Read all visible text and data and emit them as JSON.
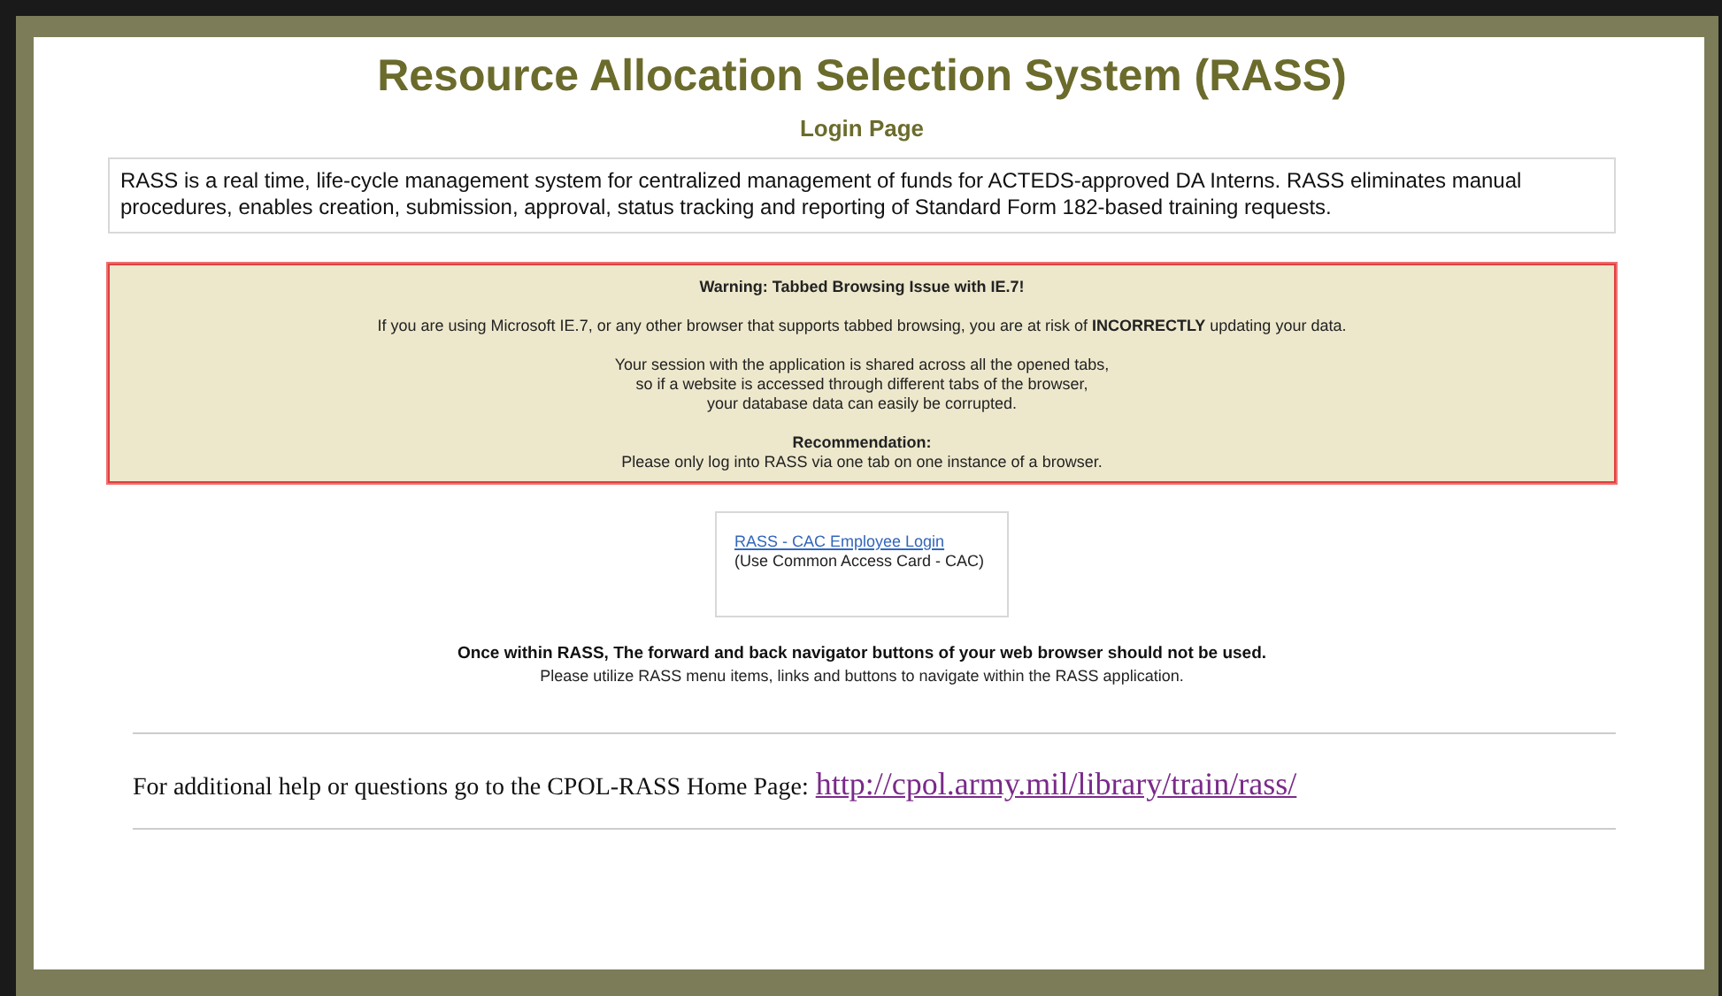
{
  "header": {
    "title": "Resource Allocation Selection System (RASS)",
    "subtitle": "Login Page"
  },
  "description": "RASS is a real time, life-cycle management system for centralized management of funds for ACTEDS-approved DA Interns. RASS eliminates manual procedures, enables creation, submission, approval, status tracking and reporting of Standard Form 182-based training requests.",
  "warning": {
    "heading": "Warning: Tabbed Browsing Issue with IE.7!",
    "risk": "If you are using Microsoft IE.7, or any other browser that supports tabbed browsing, you are at risk of **INCORRECTLY** updating your data.",
    "session_lines": [
      "Your session with the application is shared across all the opened tabs,",
      "so if a website is accessed through different tabs of the browser,",
      "your database data can easily be corrupted."
    ],
    "recommendation_heading": "Recommendation:",
    "recommendation": "Please only log into RASS via one tab on one instance of a browser."
  },
  "login": {
    "link": "RASS - CAC Employee Login",
    "note": "(Use Common Access Card - CAC)"
  },
  "navigation_notice": {
    "bold": "Once within RASS, The forward and back navigator buttons of your web browser should not be used.",
    "plain": "Please utilize RASS menu items, links and buttons to navigate within the RASS application."
  },
  "help": {
    "text": "For additional help or questions go to the CPOL-RASS Home Page:",
    "link": "http://cpol.army.mil/library/train/rass/"
  }
}
